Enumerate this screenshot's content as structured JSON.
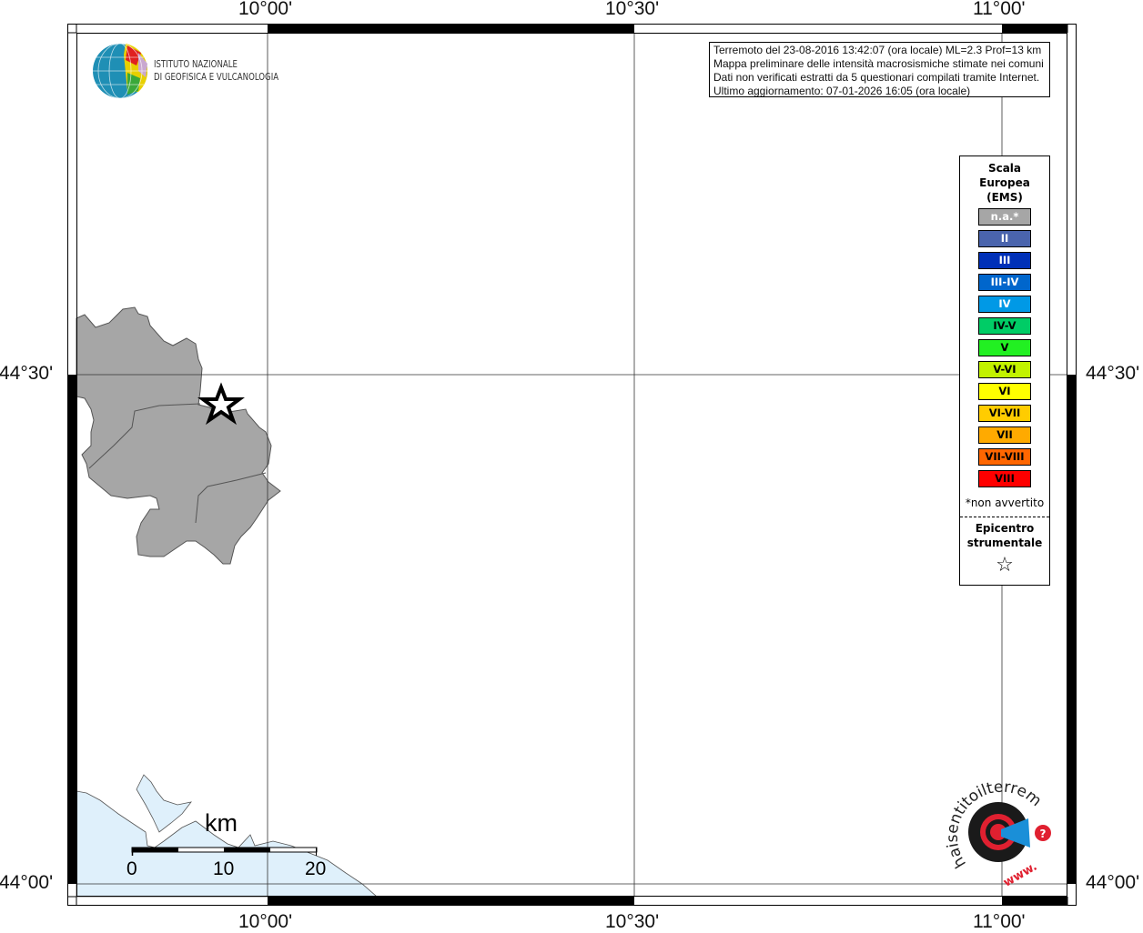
{
  "map": {
    "lon_ticks": [
      "10°00'",
      "10°30'",
      "11°00'"
    ],
    "lat_ticks": [
      "44°30'",
      "44°00'"
    ],
    "epicenter_icon": "star-icon",
    "colors": {
      "region_fill": "#a6a6a6",
      "sea_fill": "#dff0fb"
    }
  },
  "info_box": {
    "lines": [
      "Terremoto del 23-08-2016 13:42:07 (ora locale) ML=2.3 Prof=13 km",
      "Mappa preliminare delle intensità macrosismiche stimate nei comuni",
      "Dati non verificati estratti da 5 questionari compilati tramite Internet.",
      "Ultimo aggiornamento: 07-01-2026 16:05 (ora locale)"
    ]
  },
  "logo_ingv": {
    "line1": "ISTITUTO NAZIONALE",
    "line2": "DI GEOFISICA E VULCANOLOGIA"
  },
  "logo_hsit": {
    "text": "www.haisentitoilterremoto.it"
  },
  "legend": {
    "title_lines": [
      "Scala",
      "Europea",
      "(EMS)"
    ],
    "items": [
      {
        "label": "n.a.*",
        "color": "#a6a6a6",
        "text_color": "#ffffff"
      },
      {
        "label": "II",
        "color": "#4a64ad",
        "text_color": "#ffffff"
      },
      {
        "label": "III",
        "color": "#0030b8",
        "text_color": "#ffffff"
      },
      {
        "label": "III-IV",
        "color": "#0066cc",
        "text_color": "#ffffff"
      },
      {
        "label": "IV",
        "color": "#0099e6",
        "text_color": "#ffffff"
      },
      {
        "label": "IV-V",
        "color": "#00cc66",
        "text_color": "#000000"
      },
      {
        "label": "V",
        "color": "#22f022",
        "text_color": "#000000"
      },
      {
        "label": "V-VI",
        "color": "#c2f200",
        "text_color": "#000000"
      },
      {
        "label": "VI",
        "color": "#ffff00",
        "text_color": "#000000"
      },
      {
        "label": "VI-VII",
        "color": "#ffcc00",
        "text_color": "#000000"
      },
      {
        "label": "VII",
        "color": "#ffaa00",
        "text_color": "#000000"
      },
      {
        "label": "VII-VIII",
        "color": "#ff6600",
        "text_color": "#000000"
      },
      {
        "label": "VIII",
        "color": "#ff0000",
        "text_color": "#000000"
      }
    ],
    "note": "*non avvertito",
    "epicenter_lines": [
      "Epicentro",
      "strumentale"
    ],
    "epicenter_symbol": "☆"
  },
  "scale_bar": {
    "unit": "km",
    "labels": [
      "0",
      "10",
      "20"
    ]
  }
}
